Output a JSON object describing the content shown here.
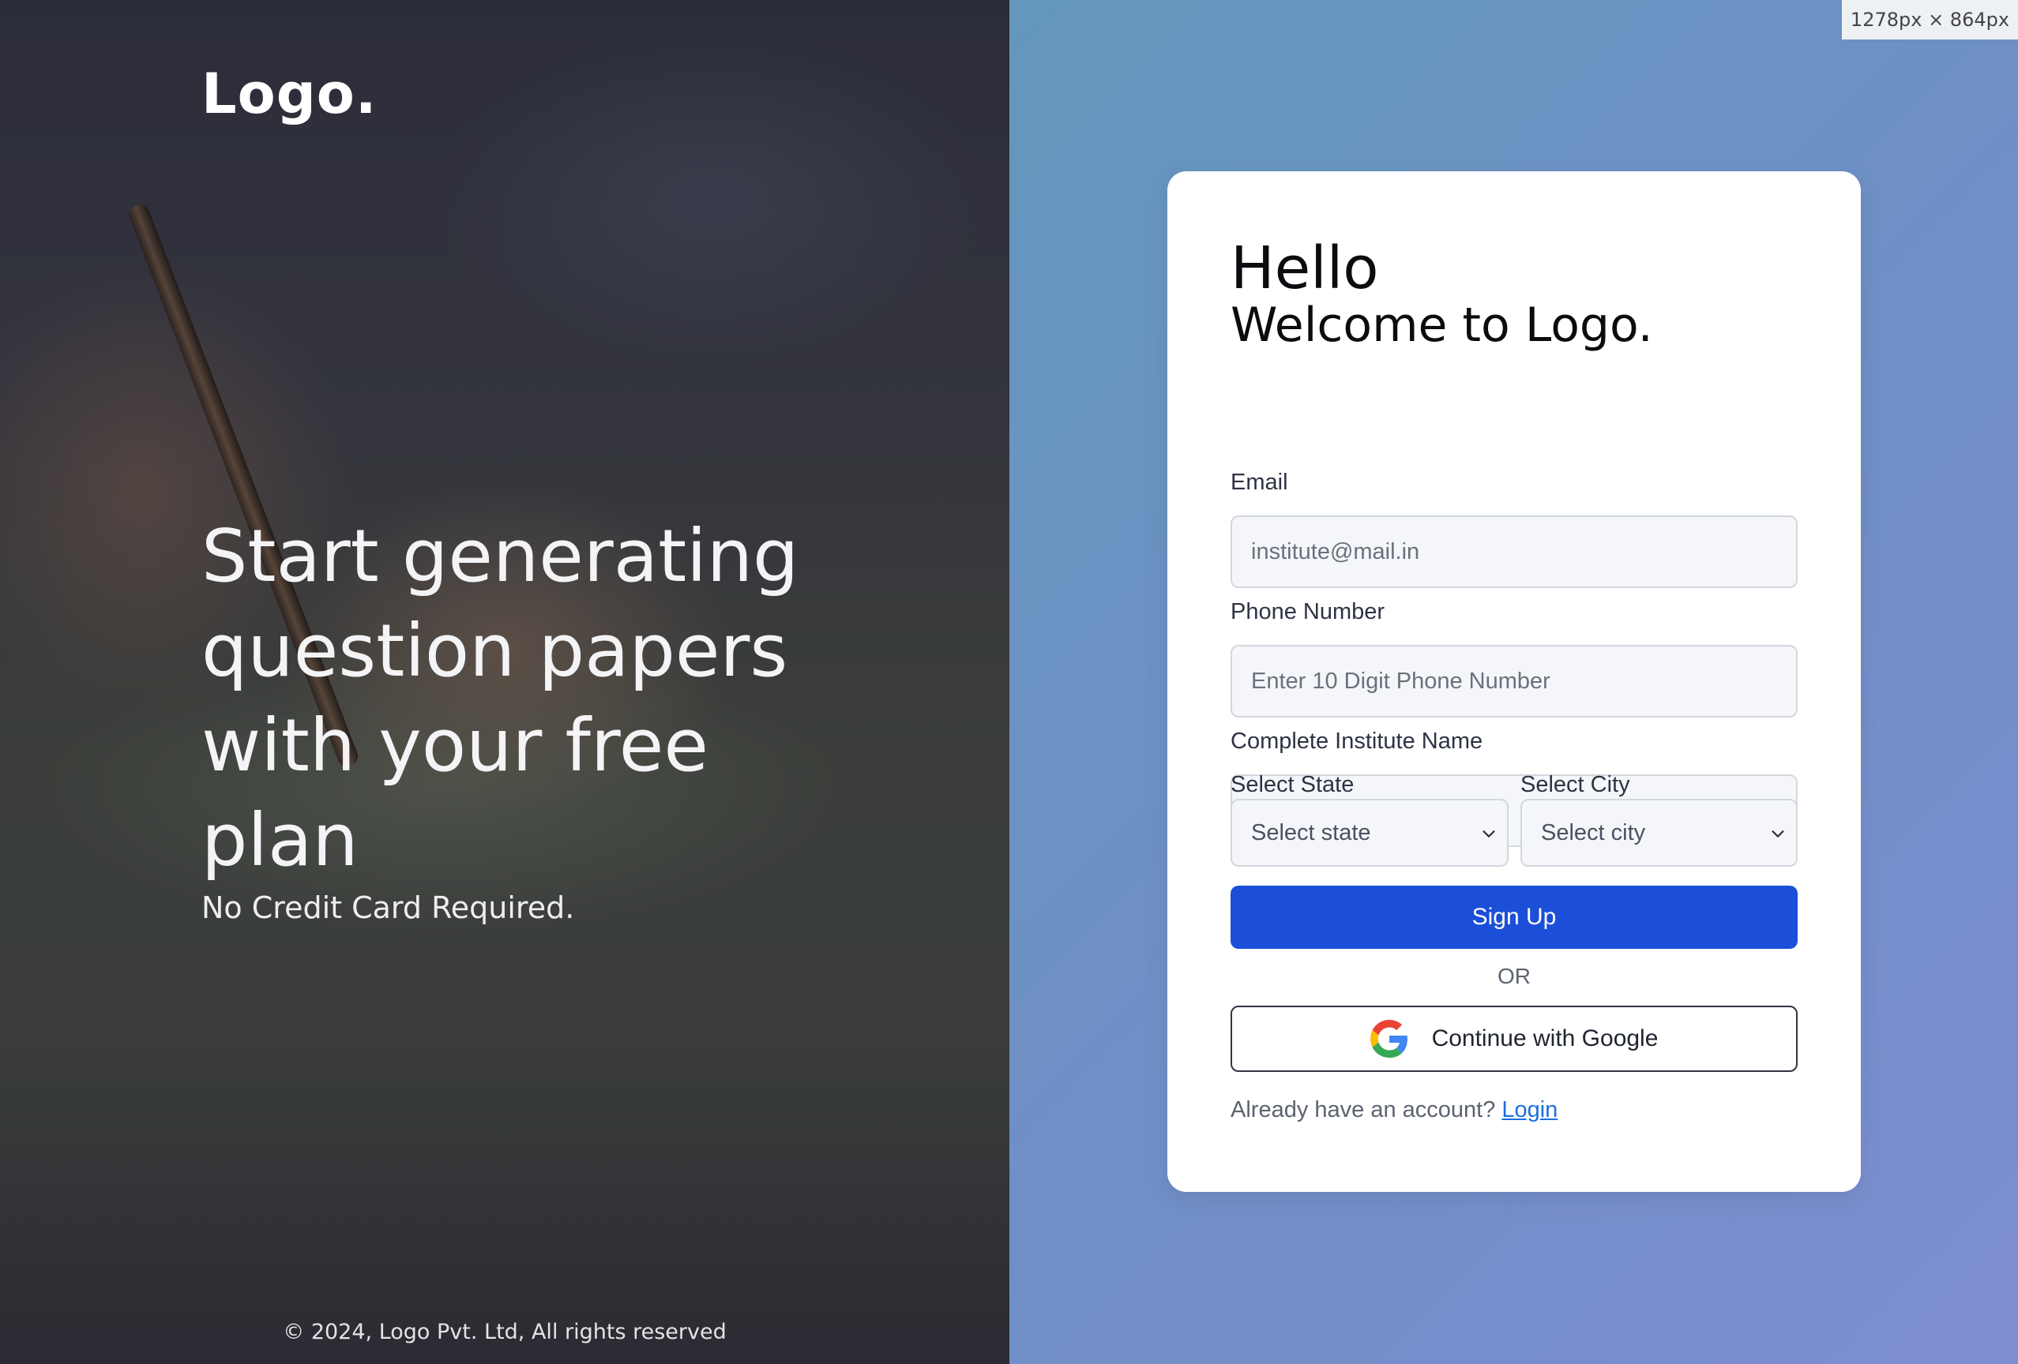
{
  "brand": {
    "logo": "Logo."
  },
  "hero": {
    "headline": "Start generating question papers with your free plan",
    "subline": "No Credit Card Required."
  },
  "footer": {
    "copyright": "© 2024, Logo Pvt. Ltd, All rights reserved"
  },
  "viewport_badge": "1278px × 864px",
  "form": {
    "greeting": "Hello",
    "welcome": "Welcome to Logo.",
    "email": {
      "label": "Email",
      "placeholder": "institute@mail.in",
      "value": ""
    },
    "phone": {
      "label": "Phone Number",
      "placeholder": "Enter 10 Digit Phone Number",
      "value": ""
    },
    "institute": {
      "label": "Complete Institute Name",
      "placeholder": "Complete Institute Name",
      "value": ""
    },
    "state": {
      "label": "Select State",
      "selected": "Select state"
    },
    "city": {
      "label": "Select City",
      "selected": "Select city"
    },
    "signup_label": "Sign Up",
    "or_label": "OR",
    "google_label": "Continue with Google",
    "already_text": "Already have an account?",
    "login_label": "Login"
  },
  "colors": {
    "primary": "#1b4fd8",
    "link": "#1c6fe0",
    "right_gradient_start": "#6497bd",
    "right_gradient_end": "#7d8ed0"
  },
  "icons": [
    "google-icon",
    "chevron-down-icon"
  ]
}
